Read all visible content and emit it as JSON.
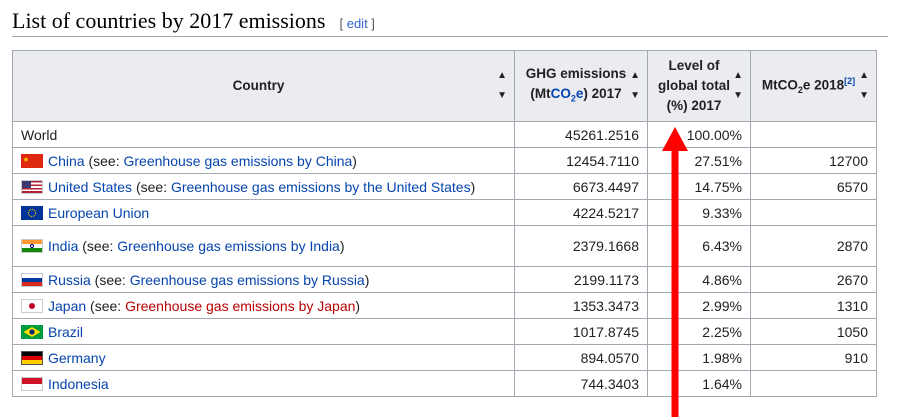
{
  "section": {
    "title": "List of countries by 2017 emissions",
    "edit_open": "[ ",
    "edit_label": "edit",
    "edit_close": " ]"
  },
  "table": {
    "headers": {
      "country": "Country",
      "ghg_line1": "GHG emissions",
      "ghg_pre": "(Mt",
      "ghg_co": "CO",
      "ghg_sub": "2",
      "ghg_e": "e",
      "ghg_post": ") 2017",
      "level_line1": "Level of",
      "level_line2": "global total",
      "level_line3": "(%) 2017",
      "mt_pre": "MtCO",
      "mt_sub": "2",
      "mt_post": "e 2018",
      "mt_ref": "[2]"
    },
    "rows": [
      {
        "country": "World",
        "see_open": "",
        "see_link": "",
        "see_close": "",
        "ghg": "45261.2516",
        "level": "100.00%",
        "mt2018": "",
        "flag": ""
      },
      {
        "country": "China",
        "see_open": " (see: ",
        "see_link": "Greenhouse gas emissions by China",
        "see_close": ")",
        "ghg": "12454.7110",
        "level": "27.51%",
        "mt2018": "12700",
        "flag": "china-flag-icon"
      },
      {
        "country": "United States",
        "see_open": " (see: ",
        "see_link": "Greenhouse gas emissions by the United States",
        "see_close": ")",
        "ghg": "6673.4497",
        "level": "14.75%",
        "mt2018": "6570",
        "flag": "usa-flag-icon"
      },
      {
        "country": "European Union",
        "see_open": "",
        "see_link": "",
        "see_close": "",
        "ghg": "4224.5217",
        "level": "9.33%",
        "mt2018": "",
        "flag": "eu-flag-icon"
      },
      {
        "country": "India",
        "see_open": " (see: ",
        "see_link": "Greenhouse gas emissions by India",
        "see_close": ")",
        "ghg": "2379.1668",
        "level": "6.43%",
        "mt2018": "2870",
        "flag": "india-flag-icon"
      },
      {
        "country": "Russia",
        "see_open": " (see: ",
        "see_link": "Greenhouse gas emissions by Russia",
        "see_close": ")",
        "ghg": "2199.1173",
        "level": "4.86%",
        "mt2018": "2670",
        "flag": "russia-flag-icon"
      },
      {
        "country": "Japan",
        "see_open": " (see: ",
        "see_link": "Greenhouse gas emissions by Japan",
        "see_close": ")",
        "ghg": "1353.3473",
        "level": "2.99%",
        "mt2018": "1310",
        "flag": "japan-flag-icon"
      },
      {
        "country": "Brazil",
        "see_open": "",
        "see_link": "",
        "see_close": "",
        "ghg": "1017.8745",
        "level": "2.25%",
        "mt2018": "1050",
        "flag": "brazil-flag-icon"
      },
      {
        "country": "Germany",
        "see_open": "",
        "see_link": "",
        "see_close": "",
        "ghg": "894.0570",
        "level": "1.98%",
        "mt2018": "910",
        "flag": "germany-flag-icon"
      },
      {
        "country": "Indonesia",
        "see_open": "",
        "see_link": "",
        "see_close": "",
        "ghg": "744.3403",
        "level": "1.64%",
        "mt2018": "",
        "flag": "indonesia-flag-icon"
      }
    ]
  },
  "annotation": {
    "icon": "arrow-up-icon",
    "color": "#ff0000"
  },
  "colors": {
    "link": "#0645ad",
    "redlink": "#ba0000",
    "header_bg": "#eaecf0",
    "border": "#a2a9b1"
  }
}
